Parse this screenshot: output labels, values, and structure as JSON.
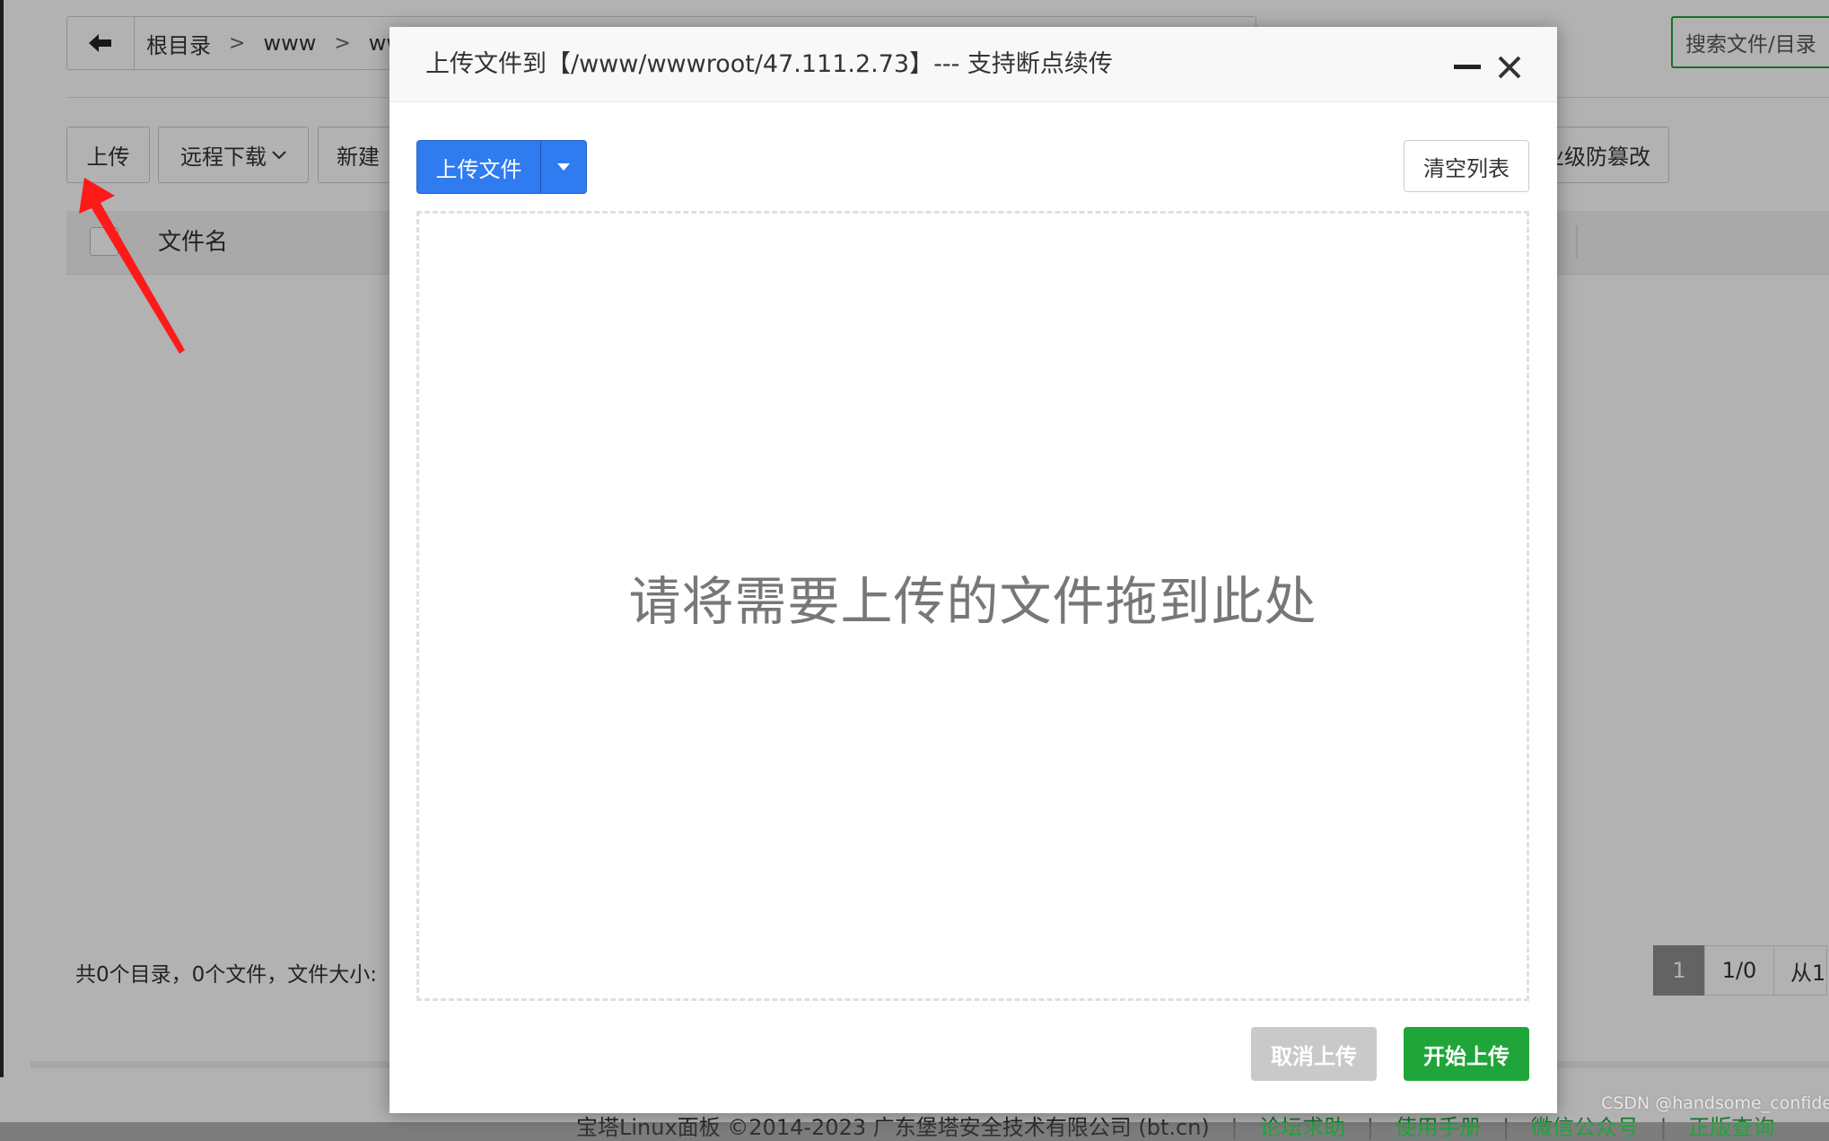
{
  "breadcrumb": {
    "back_icon": "arrow-left-icon",
    "items": [
      "根目录",
      "www",
      "ww"
    ],
    "separator": ">"
  },
  "search": {
    "placeholder": "搜索文件/目录"
  },
  "toolbar": {
    "upload": "上传",
    "remote_download": "远程下载",
    "new": "新建",
    "tamper_protect": "企业级防篡改"
  },
  "table": {
    "column_filename": "文件名"
  },
  "summary": "共0个目录，0个文件，文件大小:",
  "pagination": {
    "current": "1",
    "pages": "1/0",
    "from": "从1"
  },
  "footer": {
    "copyright": "宝塔Linux面板 ©2014-2023 广东堡塔安全技术有限公司 (bt.cn)",
    "links": [
      "论坛求助",
      "使用手册",
      "微信公众号",
      "正版查询"
    ],
    "separator": "|"
  },
  "modal": {
    "title": "上传文件到【/www/wwwroot/47.111.2.73】--- 支持断点续传",
    "minimize_icon": "minimize-icon",
    "close_icon": "close-icon",
    "upload_file_button": "上传文件",
    "clear_list_button": "清空列表",
    "dropzone_text": "请将需要上传的文件拖到此处",
    "cancel_upload_button": "取消上传",
    "start_upload_button": "开始上传"
  },
  "colors": {
    "primary_green": "#20a53a",
    "upload_blue": "#2f7bf0",
    "annotation_red": "#ff1a1a"
  },
  "watermark": "CSDN @handsome_confide"
}
